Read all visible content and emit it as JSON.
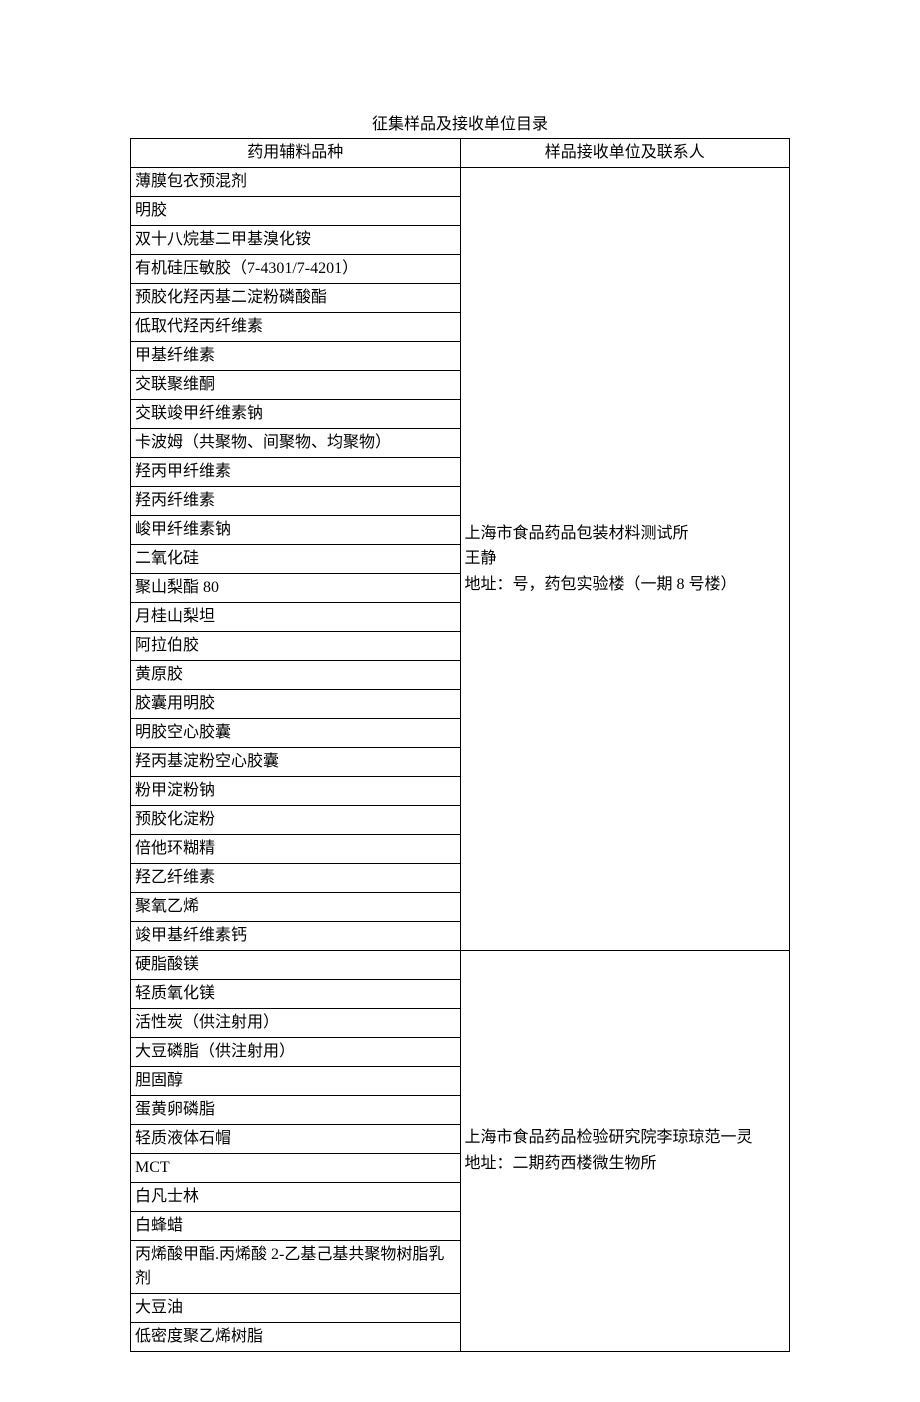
{
  "title": "征集样品及接收单位目录",
  "headers": {
    "col1": "药用辅料品种",
    "col2": "样品接收单位及联系人"
  },
  "group1": {
    "items": [
      "薄膜包衣预混剂",
      "明胶",
      "双十八烷基二甲基溴化铵",
      "有机硅压敏胶（7-4301/7-4201）",
      "预胶化羟丙基二淀粉磷酸酯",
      "低取代羟丙纤维素",
      "甲基纤维素",
      "交联聚维酮",
      "交联竣甲纤维素钠",
      "卡波姆（共聚物、间聚物、均聚物）",
      "羟丙甲纤维素",
      "羟丙纤维素",
      "峻甲纤维素钠",
      "二氧化硅",
      "聚山梨酯 80",
      "月桂山梨坦",
      "阿拉伯胶",
      "黄原胶",
      "胶囊用明胶",
      "明胶空心胶囊",
      "羟丙基淀粉空心胶囊",
      "粉甲淀粉钠",
      "预胶化淀粉",
      "倍他环糊精",
      "羟乙纤维素",
      "聚氧乙烯",
      "竣甲基纤维素钙"
    ],
    "contact_line1": "上海市食品药品包装材料测试所",
    "contact_line2": "王静",
    "contact_line3": "地址：号，药包实验楼（一期 8 号楼）"
  },
  "group2": {
    "items": [
      "硬脂酸镁",
      "轻质氧化镁",
      "活性炭（供注射用）",
      "大豆磷脂（供注射用）",
      "胆固醇",
      "蛋黄卵磷脂",
      "轻质液体石帽",
      "MCT",
      "白凡士林",
      "白蜂蜡",
      "丙烯酸甲酯.丙烯酸 2-乙基己基共聚物树脂乳剂",
      "大豆油",
      "低密度聚乙烯树脂"
    ],
    "contact_line1": "上海市食品药品检验研究院李琼琼范一灵",
    "contact_line2": "地址：二期药西楼微生物所"
  }
}
